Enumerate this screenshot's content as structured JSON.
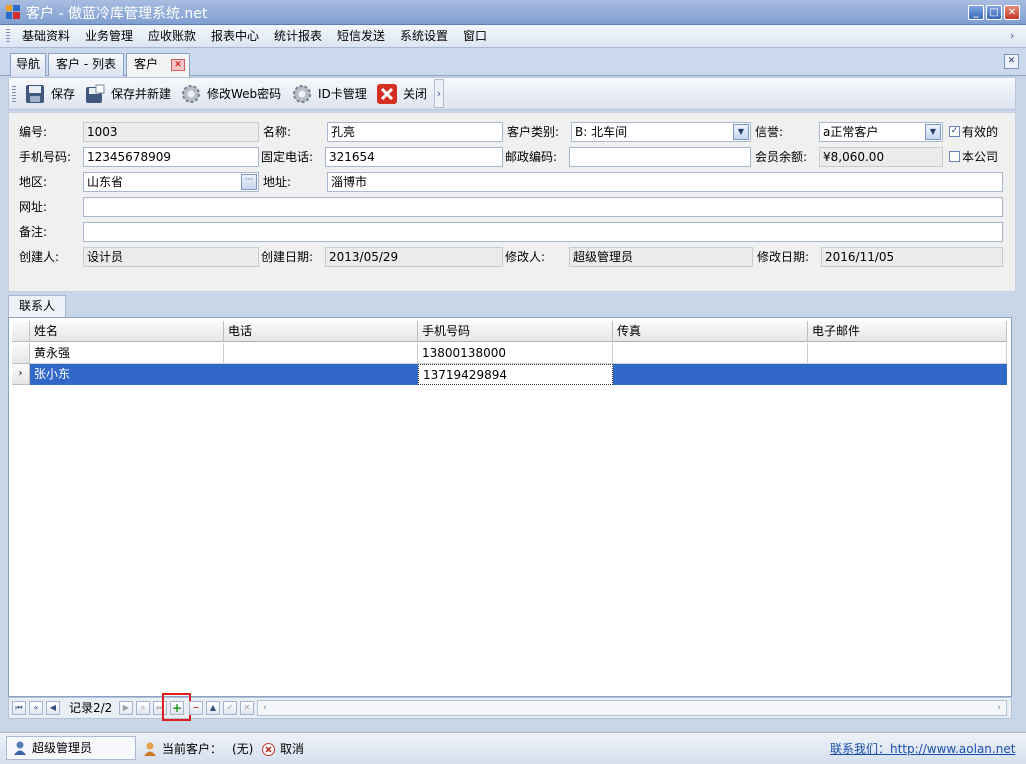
{
  "window": {
    "title": "客户 - 傲蓝冷库管理系统.net"
  },
  "menu": [
    "基础资料",
    "业务管理",
    "应收账款",
    "报表中心",
    "统计报表",
    "短信发送",
    "系统设置",
    "窗口"
  ],
  "doc_tabs": [
    {
      "label": "导航"
    },
    {
      "label": "客户 - 列表"
    },
    {
      "label": "客户",
      "active": true
    }
  ],
  "toolbar": {
    "save": "保存",
    "save_new": "保存并新建",
    "change_web_pwd": "修改Web密码",
    "idcard": "ID卡管理",
    "close": "关闭"
  },
  "form": {
    "code": {
      "label": "编号:",
      "value": "1003"
    },
    "name": {
      "label": "名称:",
      "value": "孔亮"
    },
    "category": {
      "label": "客户类别:",
      "value": "B: 北车间"
    },
    "credit": {
      "label": "信誉:",
      "value": "a正常客户"
    },
    "valid": {
      "label": "有效的",
      "checked": true
    },
    "mobile": {
      "label": "手机号码:",
      "value": "12345678909"
    },
    "phone": {
      "label": "固定电话:",
      "value": "321654"
    },
    "postcode": {
      "label": "邮政编码:",
      "value": ""
    },
    "balance": {
      "label": "会员余额:",
      "value": "¥8,060.00"
    },
    "own_company": {
      "label": "本公司",
      "checked": false
    },
    "region": {
      "label": "地区:",
      "value": "山东省"
    },
    "address": {
      "label": "地址:",
      "value": "淄博市"
    },
    "website": {
      "label": "网址:",
      "value": ""
    },
    "remark": {
      "label": "备注:",
      "value": ""
    },
    "creator": {
      "label": "创建人:",
      "value": "设计员"
    },
    "create_date": {
      "label": "创建日期:",
      "value": "2013/05/29"
    },
    "modifier": {
      "label": "修改人:",
      "value": "超级管理员"
    },
    "modify_date": {
      "label": "修改日期:",
      "value": "2016/11/05"
    }
  },
  "subtab": "联系人",
  "grid": {
    "columns": [
      "姓名",
      "电话",
      "手机号码",
      "传真",
      "电子邮件"
    ],
    "rows": [
      [
        "黄永强",
        "",
        "13800138000",
        "",
        ""
      ],
      [
        "张小东",
        "",
        "13719429894",
        "",
        ""
      ]
    ],
    "selected_row": 1
  },
  "navigator": {
    "record_text": "记录2/2"
  },
  "status": {
    "user": "超级管理员",
    "current_customer_label": "当前客户：",
    "current_customer_value": "(无)",
    "cancel": "取消",
    "contact": "联系我们：http://www.aolan.net"
  },
  "colors": {
    "accent": "#3269c8",
    "titlebar": "#7f9fd1",
    "highlight_box": "#e02020"
  }
}
